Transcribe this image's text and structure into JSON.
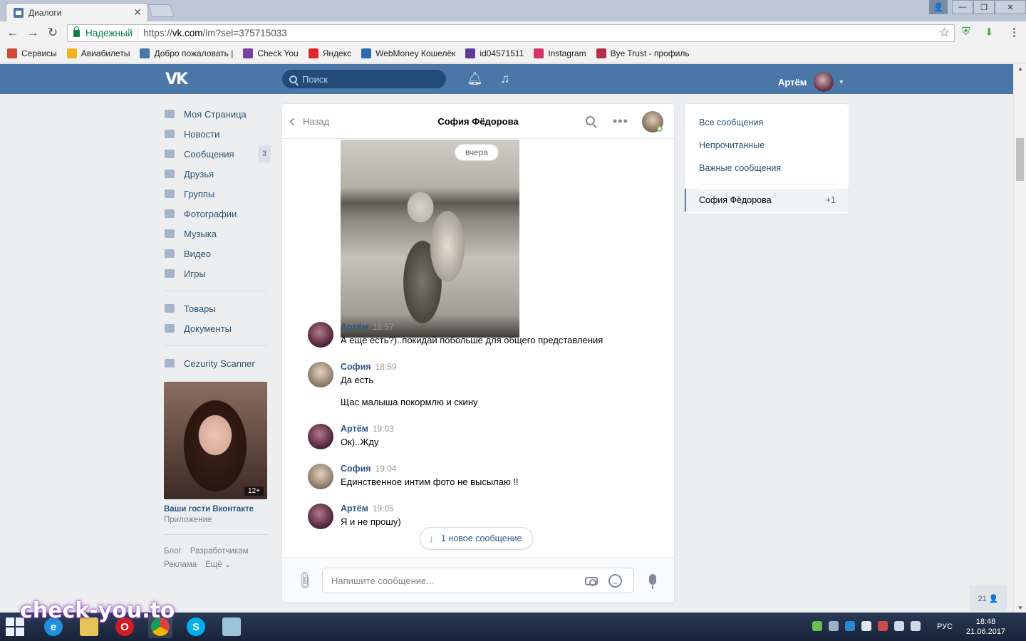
{
  "browser": {
    "tab_title": "Диалоги",
    "tab_close": "✕",
    "secure_label": "Надежный",
    "url_scheme": "https://",
    "url_host": "vk.com",
    "url_path": "/im?sel=375715033",
    "bookmarks": [
      {
        "label": "Сервисы",
        "icon": "apps-grid-icon",
        "color": "#d14836"
      },
      {
        "label": "Авиабилеты",
        "icon": "plane-icon",
        "color": "#f2b21b"
      },
      {
        "label": "Добро пожаловать |",
        "icon": "vk-icon",
        "color": "#4a76a8"
      },
      {
        "label": "Check You",
        "icon": "checkyou-icon",
        "color": "#7b3fa0"
      },
      {
        "label": "Яндекс",
        "icon": "yandex-icon",
        "color": "#e3252b"
      },
      {
        "label": "WebMoney Кошелёк",
        "icon": "webmoney-icon",
        "color": "#2a6bb1"
      },
      {
        "label": "id04571511",
        "icon": "s-icon",
        "color": "#5d3a9b"
      },
      {
        "label": "Instagram",
        "icon": "instagram-icon",
        "color": "#d6336c"
      },
      {
        "label": "Bye Trust - профиль",
        "icon": "byetrust-icon",
        "color": "#b1304d"
      }
    ]
  },
  "vk": {
    "search_placeholder": "Поиск",
    "user_name": "Артём",
    "left_menu": [
      {
        "label": "Моя Страница",
        "icon": "home-icon"
      },
      {
        "label": "Новости",
        "icon": "news-icon"
      },
      {
        "label": "Сообщения",
        "icon": "messages-icon",
        "badge": "3"
      },
      {
        "label": "Друзья",
        "icon": "friends-icon"
      },
      {
        "label": "Группы",
        "icon": "groups-icon"
      },
      {
        "label": "Фотографии",
        "icon": "photos-icon"
      },
      {
        "label": "Музыка",
        "icon": "music-icon"
      },
      {
        "label": "Видео",
        "icon": "video-icon"
      },
      {
        "label": "Игры",
        "icon": "games-icon"
      }
    ],
    "left_menu_2": [
      {
        "label": "Товары",
        "icon": "goods-icon"
      },
      {
        "label": "Документы",
        "icon": "documents-icon"
      }
    ],
    "left_menu_3": [
      {
        "label": "Cezurity Scanner",
        "icon": "app-icon"
      }
    ],
    "promo": {
      "age": "12+",
      "title": "Ваши гости Вконтакте",
      "subtitle": "Приложение"
    },
    "footer": [
      "Блог",
      "Разработчикам",
      "Реклама",
      "Ещё ⌄"
    ]
  },
  "dialog": {
    "back_label": "Назад",
    "peer_name": "София Фёдорова",
    "date_pill": "вчера",
    "messages": [
      {
        "author": "Артём",
        "time": "18:57",
        "text": "А ещё есть?)..покидай побольше для общего представления",
        "avatar": "artem"
      },
      {
        "author": "София",
        "time": "18:59",
        "text": "Да есть",
        "text2": "Щас малыша покормлю и скину",
        "avatar": "sofia"
      },
      {
        "author": "Артём",
        "time": "19:03",
        "text": "Ок)..Жду",
        "avatar": "artem"
      },
      {
        "author": "София",
        "time": "19:04",
        "text": "Единственное интим фото не высылаю !!",
        "avatar": "sofia"
      },
      {
        "author": "Артём",
        "time": "19:05",
        "text": "Я и не прошу)",
        "avatar": "artem"
      }
    ],
    "new_message_pill": "1 новое сообщение",
    "composer_placeholder": "Напишите сообщение..."
  },
  "folders": {
    "items": [
      "Все сообщения",
      "Непрочитанные",
      "Важные сообщения"
    ],
    "active": {
      "label": "София Фёдорова",
      "count": "+1"
    }
  },
  "side_widget": "21 👤",
  "taskbar": {
    "lang": "РУС",
    "time": "18:48",
    "date": "21.06.2017"
  },
  "watermark": "check-you.to"
}
